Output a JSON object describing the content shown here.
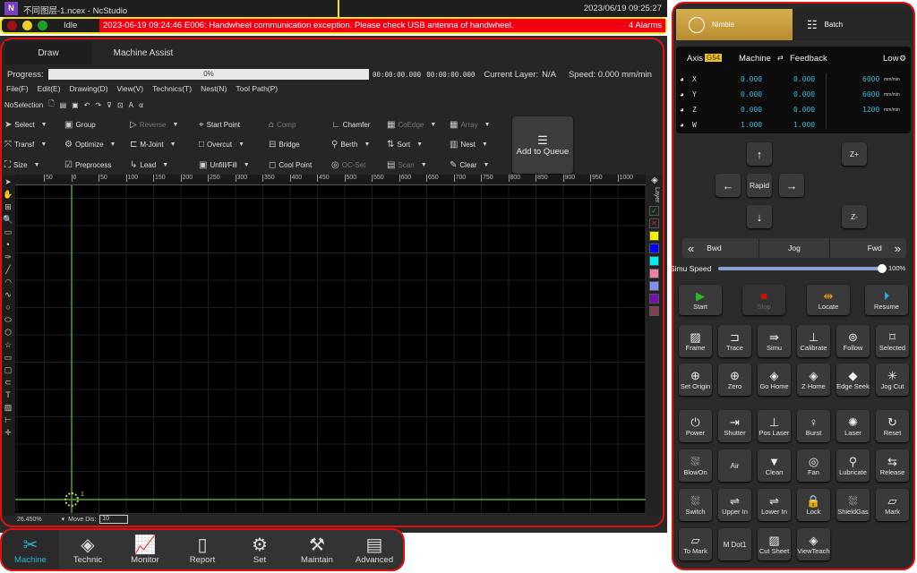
{
  "titlebar": {
    "title": "不同图层-1.ncex - NcStudio",
    "datetime": "2023/06/19 09:25:27"
  },
  "status": {
    "state": "Idle",
    "alarm_message": "2023-06-19 09:24:46  E006: Handwheel communication exception. Please check USB antenna of handwheel.",
    "alarm_count": "4 Alarms",
    "leds": [
      "#a01010",
      "#e8d020",
      "#20a020"
    ]
  },
  "tabs": [
    {
      "label": "Draw",
      "active": true
    },
    {
      "label": "Machine Assist",
      "active": false
    }
  ],
  "progress": {
    "label": "Progress:",
    "value_text": "0%",
    "value": 0,
    "time_elapsed": "00:00:00.000",
    "time_total": "00:00:00.000",
    "current_layer_label": "Current Layer:",
    "current_layer": "N/A",
    "speed": "Speed: 0.000 mm/min"
  },
  "menu": [
    "File(F)",
    "Edit(E)",
    "Drawing(D)",
    "View(V)",
    "Technics(T)",
    "Nest(N)",
    "Tool Path(P)"
  ],
  "selection": "NoSelection",
  "toolbar": [
    [
      {
        "label": "Select",
        "icon": "pointer-icon",
        "caret": true
      },
      {
        "label": "Transf",
        "icon": "transform-icon",
        "caret": true
      },
      {
        "label": "Size",
        "icon": "size-icon",
        "caret": true
      }
    ],
    [
      {
        "label": "Group",
        "icon": "group-icon"
      },
      {
        "label": "Optimize",
        "icon": "optimize-icon",
        "caret": true
      },
      {
        "label": "Preprocess",
        "icon": "checkbox-icon"
      }
    ],
    [
      {
        "label": "Reverse",
        "icon": "reverse-icon",
        "caret": true,
        "disabled": true
      },
      {
        "label": "M-Joint",
        "icon": "mjoint-icon",
        "caret": true
      },
      {
        "label": "Lead",
        "icon": "lead-icon",
        "caret": true
      }
    ],
    [
      {
        "label": "Start Point",
        "icon": "start-point-icon"
      },
      {
        "label": "Overcut",
        "icon": "overcut-icon",
        "caret": true
      },
      {
        "label": "Unfill/Fill",
        "icon": "fill-icon",
        "caret": true
      }
    ],
    [
      {
        "label": "Comp",
        "icon": "comp-icon",
        "disabled": true
      },
      {
        "label": "Bridge",
        "icon": "bridge-icon"
      },
      {
        "label": "Cool Point",
        "icon": "cool-point-icon"
      }
    ],
    [
      {
        "label": "Chamfer",
        "icon": "chamfer-icon"
      },
      {
        "label": "Berth",
        "icon": "berth-icon",
        "caret": true
      },
      {
        "label": "OC-Set",
        "icon": "oc-set-icon",
        "disabled": true
      }
    ],
    [
      {
        "label": "CoEdge",
        "icon": "coedge-icon",
        "caret": true,
        "disabled": true
      },
      {
        "label": "Sort",
        "icon": "sort-icon",
        "caret": true
      },
      {
        "label": "Scan",
        "icon": "scan-icon",
        "caret": true,
        "disabled": true
      }
    ],
    [
      {
        "label": "Array",
        "icon": "array-icon",
        "caret": true,
        "disabled": true
      },
      {
        "label": "Nest",
        "icon": "nest-icon",
        "caret": true
      },
      {
        "label": "Clear",
        "icon": "clear-icon",
        "caret": true
      }
    ]
  ],
  "add_to_queue": "Add to Queue",
  "ruler_labels": [
    "50",
    "0",
    "50",
    "100",
    "150",
    "200",
    "250",
    "300",
    "350",
    "400",
    "450",
    "500",
    "550",
    "600",
    "650",
    "700",
    "750",
    "800",
    "850",
    "900",
    "950",
    "1000"
  ],
  "layer_panel": {
    "title": "Layer",
    "colors": [
      "#f0f000",
      "#0000ff",
      "#00f0f0",
      "#f080a0",
      "#8090f0",
      "#7010b0",
      "#804050"
    ]
  },
  "canvas": {
    "origin_label": "1"
  },
  "footer": {
    "zoom": "26.450%",
    "move_dis_label": "Move Dis:",
    "move_dis_value": "10"
  },
  "bottom_nav": [
    {
      "label": "Machine",
      "icon": "machine-icon",
      "active": true
    },
    {
      "label": "Technic",
      "icon": "layers-icon"
    },
    {
      "label": "Monitor",
      "icon": "monitor-icon"
    },
    {
      "label": "Report",
      "icon": "report-icon"
    },
    {
      "label": "Set",
      "icon": "gear-icon"
    },
    {
      "label": "Maintain",
      "icon": "wrench-icon"
    },
    {
      "label": "Advanced",
      "icon": "advanced-icon"
    }
  ],
  "mode_tabs": [
    {
      "label": "Nimble",
      "active": true
    },
    {
      "label": "Batch"
    }
  ],
  "coords": {
    "axis_label": "Axis",
    "wcs": "G54",
    "machine_label": "Machine",
    "feedback_label": "Feedback",
    "speed_mode": "Low",
    "rows": [
      {
        "axis": "X",
        "machine": "0.000",
        "feedback": "0.000",
        "speed": "6000",
        "unit": "mm/min"
      },
      {
        "axis": "Y",
        "machine": "0.000",
        "feedback": "0.000",
        "speed": "6000",
        "unit": "mm/min"
      },
      {
        "axis": "Z",
        "machine": "0.000",
        "feedback": "0.000",
        "speed": "1200",
        "unit": "mm/min"
      },
      {
        "axis": "W",
        "machine": "1.000",
        "feedback": "1.000",
        "speed": "",
        "unit": ""
      }
    ]
  },
  "jog": {
    "rapid": "Rapid",
    "z_plus": "Z+",
    "z_minus": "Z-",
    "bwd": "Bwd",
    "jog": "Jog",
    "fwd": "Fwd"
  },
  "simu_speed": {
    "label": "Simu Speed",
    "value_text": "100%",
    "value": 100
  },
  "run_buttons": [
    {
      "label": "Start",
      "color": "#20c020",
      "icon": "▶"
    },
    {
      "label": "Stop",
      "color": "#c01010",
      "icon": "■",
      "disabled": true
    },
    {
      "label": "Locate",
      "color": "#f0a010",
      "icon": "⇹"
    },
    {
      "label": "Resume",
      "color": "#20b8e0",
      "icon": "⏵"
    }
  ],
  "func_buttons": [
    "Frame",
    "Trace",
    "Simu",
    "Calibrate",
    "Follow",
    "Selected",
    "Set Origin",
    "Zero",
    "Go Home",
    "Z Home",
    "Edge Seek",
    "Jog Cut",
    "Power",
    "Shutter",
    "Pos Laser",
    "Burst",
    "Laser",
    "Reset",
    "BlowOn",
    "Air",
    "Clean",
    "Fan",
    "Lubricate",
    "Release",
    "Switch",
    "Upper In",
    "Lower In",
    "Lock",
    "ShieldGas",
    "Mark",
    "To Mark",
    "M Dot1",
    "Cut Sheet",
    "ViewTeach"
  ]
}
